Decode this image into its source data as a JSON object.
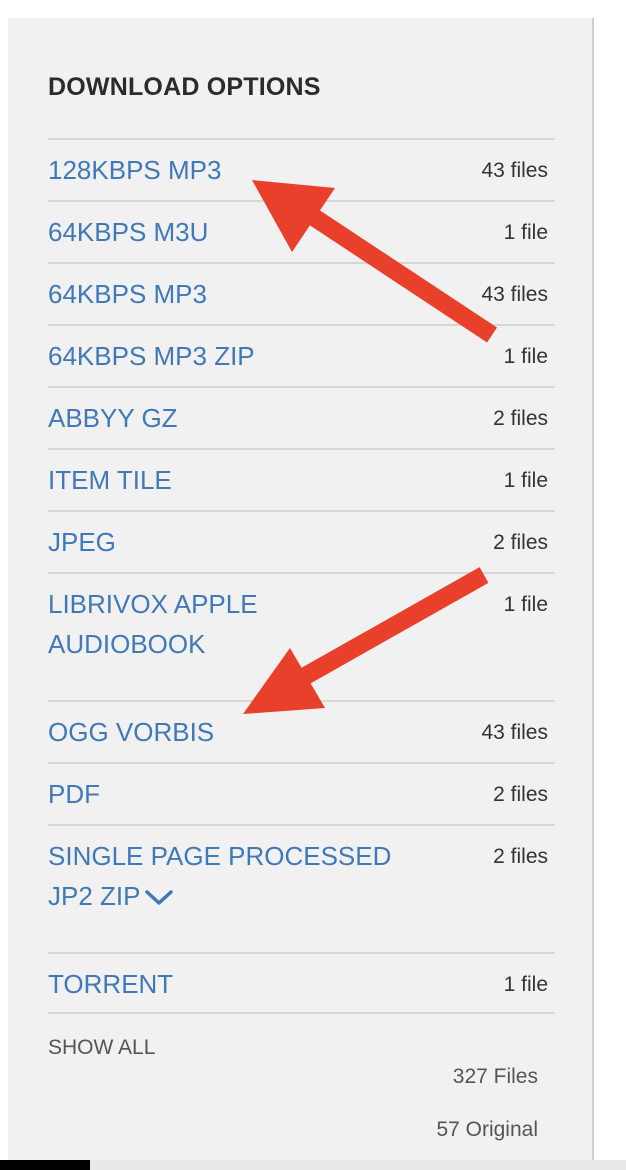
{
  "panel": {
    "title": "DOWNLOAD OPTIONS",
    "items": [
      {
        "label": "128KBPS MP3",
        "count": "43 files"
      },
      {
        "label": "64KBPS M3U",
        "count": "1 file"
      },
      {
        "label": "64KBPS MP3",
        "count": "43 files"
      },
      {
        "label": "64KBPS MP3 ZIP",
        "count": "1 file"
      },
      {
        "label": "ABBYY GZ",
        "count": "2 files"
      },
      {
        "label": "ITEM TILE",
        "count": "1 file"
      },
      {
        "label": "JPEG",
        "count": "2 files"
      },
      {
        "label": "LIBRIVOX APPLE AUDIOBOOK",
        "count": "1 file"
      },
      {
        "label": "OGG VORBIS",
        "count": "43 files"
      },
      {
        "label": "PDF",
        "count": "2 files"
      },
      {
        "label": "SINGLE PAGE PROCESSED JP2 ZIP",
        "count": "2 files",
        "icon": "chevron-down-icon"
      },
      {
        "label": "TORRENT",
        "count": "1 file"
      }
    ],
    "show_all": "SHOW ALL",
    "total_files": "327 Files",
    "original": "57 Original"
  },
  "annotations": {
    "arrow_color": "#e8402a",
    "arrow_icon": "arrow-annotation"
  },
  "link_color": "#4178b7"
}
